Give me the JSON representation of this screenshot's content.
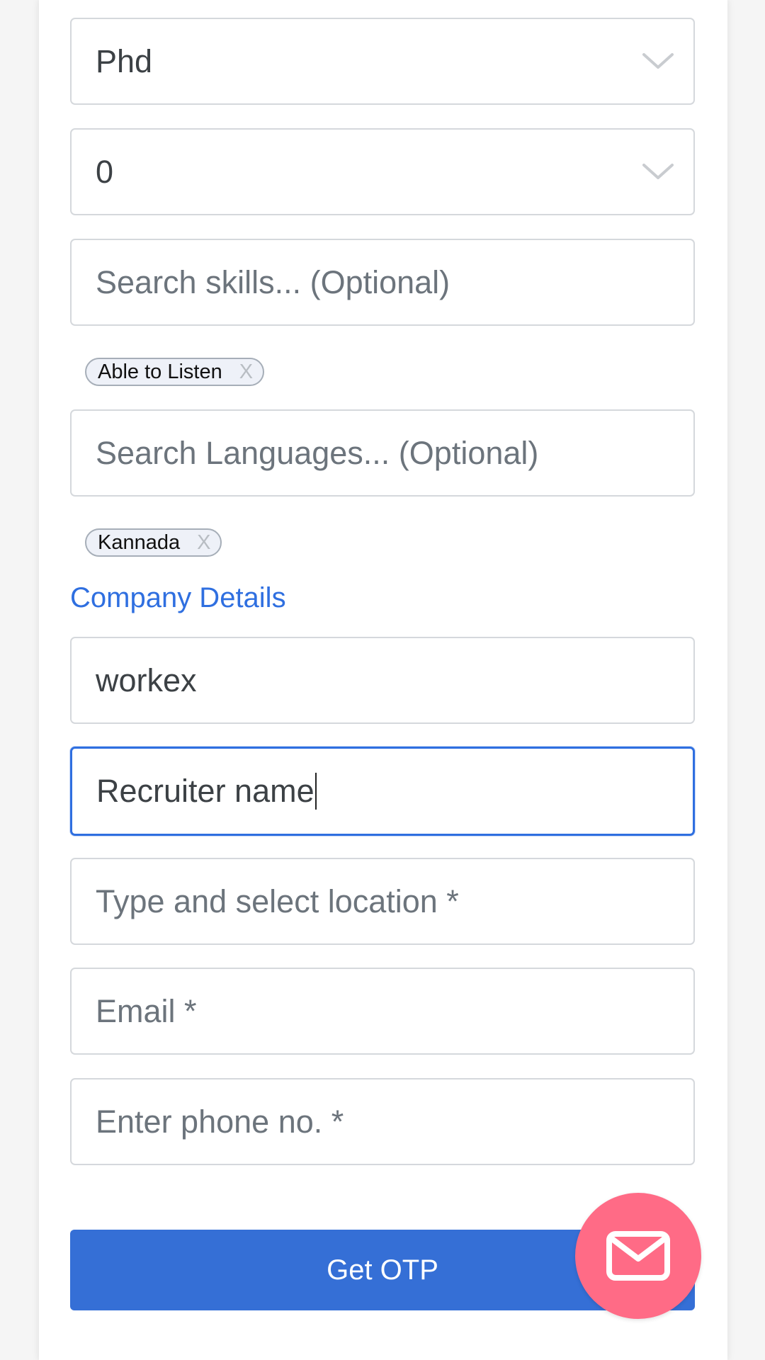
{
  "form": {
    "education": {
      "value": "Phd"
    },
    "experience": {
      "value": "0"
    },
    "skills": {
      "placeholder": "Search skills... (Optional)",
      "chips": [
        {
          "label": "Able to Listen",
          "remove": "X"
        }
      ]
    },
    "languages": {
      "placeholder": "Search Languages... (Optional)",
      "chips": [
        {
          "label": "Kannada",
          "remove": "X"
        }
      ]
    },
    "company_section_title": "Company Details",
    "company_name": {
      "value": "workex"
    },
    "recruiter_name": {
      "value": "Recruiter name"
    },
    "location": {
      "placeholder": "Type and select location *"
    },
    "email": {
      "placeholder": "Email *"
    },
    "phone": {
      "placeholder": "Enter phone no. *"
    },
    "submit_label": "Get OTP"
  },
  "icons": {
    "dropdown": "chevron-down-icon",
    "fab": "mail-icon"
  },
  "colors": {
    "accent": "#2f6fe0",
    "button": "#356fd6",
    "fab": "#ff6b86",
    "border": "#d5d8dc"
  }
}
